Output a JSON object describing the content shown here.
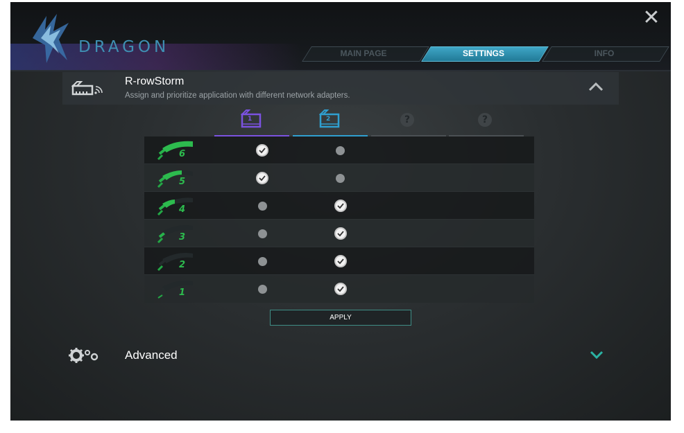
{
  "app": {
    "brand": "DRAGON",
    "close_glyph": "✕"
  },
  "tabs": [
    {
      "label": "MAIN PAGE",
      "active": false
    },
    {
      "label": "SETTINGS",
      "active": true
    },
    {
      "label": "INFO",
      "active": false
    }
  ],
  "section": {
    "title": "R-rowStorm",
    "subtitle": "Assign and prioritize application with different network adapters.",
    "icon": "network-adapter-wifi-icon",
    "collapse_icon": "chevron-up-icon"
  },
  "adapters": [
    {
      "label": "1",
      "color": "#7b52e0",
      "icon": "adapter-1-icon"
    },
    {
      "label": "2",
      "color": "#2f9fd0",
      "icon": "adapter-2-icon"
    },
    {
      "label": "?",
      "color": "#4b5054",
      "icon": "unknown-adapter-icon"
    },
    {
      "label": "?",
      "color": "#4b5054",
      "icon": "unknown-adapter-icon"
    }
  ],
  "priorities": [
    {
      "level": "6",
      "adapter1": true,
      "adapter2": false
    },
    {
      "level": "5",
      "adapter1": true,
      "adapter2": false
    },
    {
      "level": "4",
      "adapter1": false,
      "adapter2": true
    },
    {
      "level": "3",
      "adapter1": false,
      "adapter2": true
    },
    {
      "level": "2",
      "adapter1": false,
      "adapter2": true
    },
    {
      "level": "1",
      "adapter1": false,
      "adapter2": true
    }
  ],
  "apply_label": "APPLY",
  "advanced": {
    "label": "Advanced",
    "icon": "gears-icon",
    "expand_icon": "chevron-down-icon"
  },
  "colors": {
    "accent": "#3fa6c6",
    "brand": "#3f8fb3",
    "priority_green": "#2dbb4e",
    "chevron": "#2bb3a3"
  }
}
